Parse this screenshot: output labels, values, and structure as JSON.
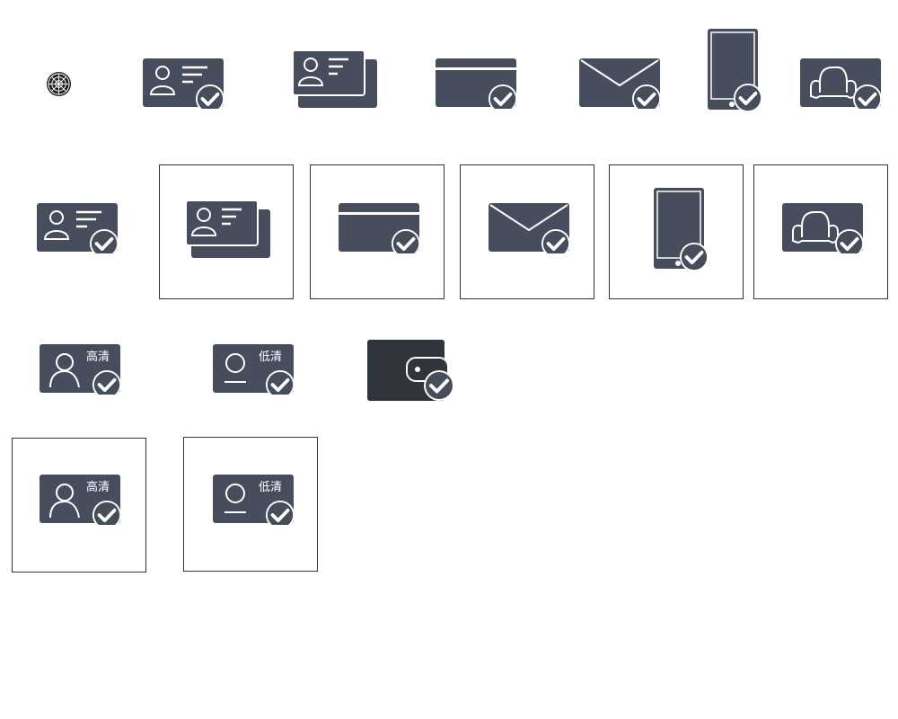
{
  "colors": {
    "card": "#474d5c",
    "card_dark": "#2f343d",
    "line": "#ffffff",
    "tile_border": "#333333"
  },
  "icons": {
    "logo": "target-emblem-icon",
    "id_card": "id-card-check-icon",
    "multi_cards": "multiple-cards-check-icon",
    "bank_card": "bank-card-check-icon",
    "email": "email-check-icon",
    "phone": "mobile-phone-check-icon",
    "car": "vehicle-check-icon",
    "photo_hd": "photo-high-definition-check-icon",
    "photo_ld": "photo-low-definition-check-icon",
    "wallet": "wallet-check-icon"
  },
  "labels": {
    "hd": "高清",
    "ld": "低清"
  }
}
